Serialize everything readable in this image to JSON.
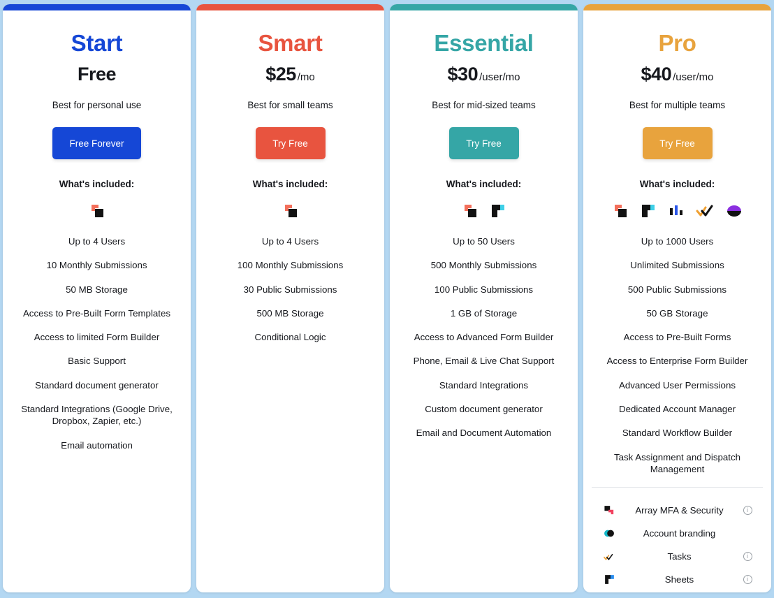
{
  "page": {
    "background_color": "#b3d7f2",
    "included_label": "What's included:"
  },
  "plans": [
    {
      "id": "start",
      "name": "Start",
      "accent_color": "#1547d6",
      "price_amount": "Free",
      "price_period": "",
      "tagline": "Best for personal use",
      "cta_label": "Free Forever",
      "cta_color": "#1547d6",
      "product_icons": [
        "forms-icon"
      ],
      "features": [
        "Up to 4 Users",
        "10 Monthly Submissions",
        "50 MB Storage",
        "Access to Pre-Built Form Templates",
        "Access to limited Form Builder",
        "Basic Support",
        "Standard document generator",
        "Standard Integrations (Google Drive, Dropbox, Zapier, etc.)",
        "Email automation"
      ],
      "addons": []
    },
    {
      "id": "smart",
      "name": "Smart",
      "accent_color": "#e8543f",
      "price_amount": "$25",
      "price_period": "/mo",
      "tagline": "Best for small teams",
      "cta_label": "Try Free",
      "cta_color": "#e8543f",
      "product_icons": [
        "forms-icon"
      ],
      "features": [
        "Up to 4 Users",
        "100 Monthly Submissions",
        "30 Public Submissions",
        "500 MB Storage",
        "Conditional Logic"
      ],
      "addons": []
    },
    {
      "id": "essential",
      "name": "Essential",
      "accent_color": "#35a6a6",
      "price_amount": "$30",
      "price_period": "/user/mo",
      "tagline": "Best for mid-sized teams",
      "cta_label": "Try Free",
      "cta_color": "#35a6a6",
      "product_icons": [
        "forms-icon",
        "documents-icon"
      ],
      "features": [
        "Up to 50 Users",
        "500 Monthly Submissions",
        "100 Public Submissions",
        "1 GB of Storage",
        "Access to Advanced Form Builder",
        "Phone, Email & Live Chat Support",
        "Standard Integrations",
        "Custom document generator",
        "Email and Document Automation"
      ],
      "addons": []
    },
    {
      "id": "pro",
      "name": "Pro",
      "accent_color": "#e8a33d",
      "price_amount": "$40",
      "price_period": "/user/mo",
      "tagline": "Best for multiple teams",
      "cta_label": "Try Free",
      "cta_color": "#e8a33d",
      "product_icons": [
        "forms-icon",
        "documents-icon",
        "tables-icon",
        "tasks-icon",
        "branding-icon"
      ],
      "features": [
        "Up to 1000 Users",
        "Unlimited Submissions",
        "500 Public Submissions",
        "50 GB Storage",
        "Access to Pre-Built Forms",
        "Access to Enterprise Form Builder",
        "Advanced User Permissions",
        "Dedicated Account Manager",
        "Standard Workflow Builder",
        "Task Assignment and Dispatch Management"
      ],
      "addons": [
        {
          "icon": "mfa-security-icon",
          "label": "Array MFA & Security",
          "has_info": true
        },
        {
          "icon": "account-branding-icon",
          "label": "Account branding",
          "has_info": false
        },
        {
          "icon": "tasks-check-icon",
          "label": "Tasks",
          "has_info": true
        },
        {
          "icon": "sheets-icon",
          "label": "Sheets",
          "has_info": true
        }
      ]
    }
  ]
}
